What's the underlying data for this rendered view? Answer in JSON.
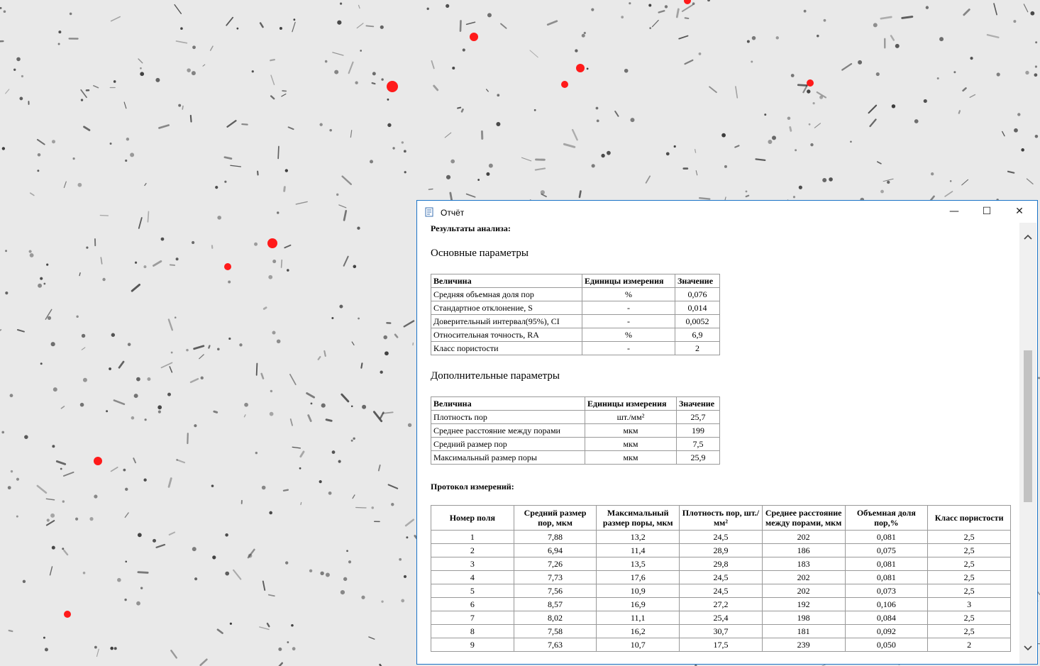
{
  "window": {
    "title": "Отчёт",
    "minimize_glyph": "—",
    "maximize_glyph": "☐",
    "close_glyph": "✕"
  },
  "report": {
    "results_heading": "Результаты анализа:",
    "main_section_title": "Основные параметры",
    "main_table": {
      "headers": [
        "Величина",
        "Единицы измерения",
        "Значение"
      ],
      "rows": [
        [
          "Средняя объемная доля пор",
          "%",
          "0,076"
        ],
        [
          "Стандартное отклонение, S",
          "-",
          "0,014"
        ],
        [
          "Доверительный интервал(95%), CI",
          "-",
          "0,0052"
        ],
        [
          "Относительная точность, RA",
          "%",
          "6,9"
        ],
        [
          "Класс пористости",
          "-",
          "2"
        ]
      ]
    },
    "extra_section_title": "Дополнительные параметры",
    "extra_table": {
      "headers": [
        "Величина",
        "Единицы измерения",
        "Значение"
      ],
      "rows": [
        [
          "Плотность пор",
          "шт./мм²",
          "25,7"
        ],
        [
          "Среднее расстояние между порами",
          "мкм",
          "199"
        ],
        [
          "Средний размер пор",
          "мкм",
          "7,5"
        ],
        [
          "Максимальный размер поры",
          "мкм",
          "25,9"
        ]
      ]
    },
    "protocol_heading": "Протокол измерений:",
    "protocol_table": {
      "headers": [
        "Номер поля",
        "Средний размер пор, мкм",
        "Максимальный размер поры, мкм",
        "Плотность пор, шт./мм²",
        "Среднее расстояние между порами, мкм",
        "Объемная доля пор,%",
        "Класс пористости"
      ],
      "rows": [
        [
          "1",
          "7,88",
          "13,2",
          "24,5",
          "202",
          "0,081",
          "2,5"
        ],
        [
          "2",
          "6,94",
          "11,4",
          "28,9",
          "186",
          "0,075",
          "2,5"
        ],
        [
          "3",
          "7,26",
          "13,5",
          "29,8",
          "183",
          "0,081",
          "2,5"
        ],
        [
          "4",
          "7,73",
          "17,6",
          "24,5",
          "202",
          "0,081",
          "2,5"
        ],
        [
          "5",
          "7,56",
          "10,9",
          "24,5",
          "202",
          "0,073",
          "2,5"
        ],
        [
          "6",
          "8,57",
          "16,9",
          "27,2",
          "192",
          "0,106",
          "3"
        ],
        [
          "7",
          "8,02",
          "11,1",
          "25,4",
          "198",
          "0,084",
          "2,5"
        ],
        [
          "8",
          "7,58",
          "16,2",
          "30,7",
          "181",
          "0,092",
          "2,5"
        ],
        [
          "9",
          "7,63",
          "10,7",
          "17,5",
          "239",
          "0,050",
          "2"
        ]
      ]
    }
  },
  "colors": {
    "pore_highlight": "#ff1a1a",
    "window_border": "#1a73c7",
    "micrograph_bg": "#e9e9e9"
  }
}
